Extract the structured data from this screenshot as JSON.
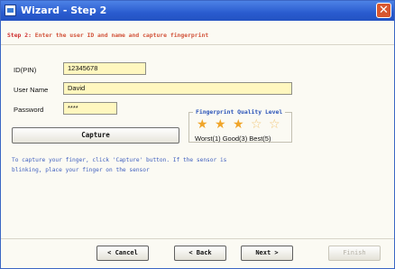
{
  "window": {
    "title": "Wizard - Step 2",
    "close_symbol": "✕",
    "app_icon": "wizard-app-icon"
  },
  "step": {
    "prefix": "Step 2:",
    "text": "Enter the user ID and name and capture fingerprint"
  },
  "form": {
    "id_label": "ID(PIN)",
    "id_value": "12345678",
    "username_label": "User Name",
    "username_value": "David",
    "password_label": "Password",
    "password_value": "****",
    "capture_label": "Capture"
  },
  "quality": {
    "title": "Fingerprint Quality Level",
    "legend": "Worst(1) Good(3) Best(5)",
    "stars_total": 5,
    "stars_filled": 3,
    "filled_color": "#f0a52a",
    "empty_color": "#f1c77a"
  },
  "hint": {
    "line1": "To capture your finger, click 'Capture' button. If the sensor is",
    "line2": "blinking, place your finger on the sensor"
  },
  "buttons": {
    "cancel": "< Cancel",
    "back": "< Back",
    "next": "Next >",
    "finish": "Finish"
  },
  "colors": {
    "titlebar": "#2a5ccf",
    "input_background": "#fff7bf",
    "step_text": "#d2533a",
    "hint_text": "#3f5fbe"
  }
}
